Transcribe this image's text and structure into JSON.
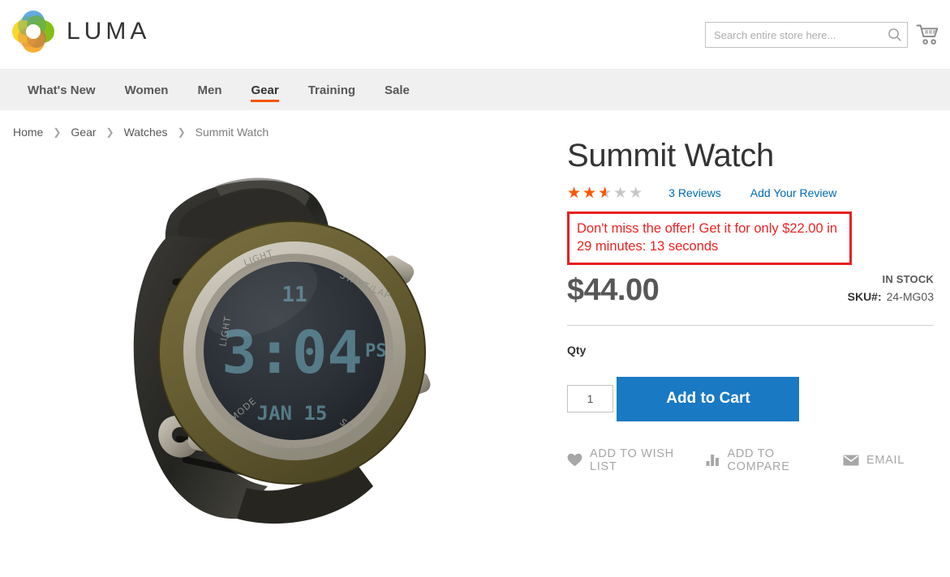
{
  "header": {
    "brand_name": "LUMA",
    "logo_icon": "luma-flower-logo",
    "search": {
      "placeholder": "Search entire store here...",
      "value": "",
      "icon": "search-icon"
    },
    "cart_icon": "shopping-cart-icon"
  },
  "nav": {
    "items": [
      {
        "label": "What's New",
        "active": false
      },
      {
        "label": "Women",
        "active": false
      },
      {
        "label": "Men",
        "active": false
      },
      {
        "label": "Gear",
        "active": true
      },
      {
        "label": "Training",
        "active": false
      },
      {
        "label": "Sale",
        "active": false
      }
    ],
    "active_color": "#f45500"
  },
  "breadcrumb": {
    "separator": "❯",
    "items": [
      "Home",
      "Gear",
      "Watches",
      "Summit Watch"
    ]
  },
  "product": {
    "title": "Summit Watch",
    "image_alt": "Summit Watch digital sport watch with black strap and olive bezel",
    "rating": {
      "value": 2.5,
      "max": 5,
      "percent": "50%",
      "star_glyph": "★★★★★",
      "color": "#ff5501"
    },
    "reviews_link": "3 Reviews",
    "add_review_link": "Add Your Review",
    "offer": {
      "text": "Don't miss the offer! Get it for only $22.00 in 29 minutes: 13 seconds",
      "offer_price": "$22.00",
      "minutes": "29",
      "seconds": "13",
      "border_color": "#e81f1f",
      "text_color": "#ef2222"
    },
    "price": "$44.00",
    "stock_status": "IN STOCK",
    "sku_label": "SKU#:",
    "sku_value": "24-MG03",
    "qty_label": "Qty",
    "qty_value": "1",
    "add_to_cart_label": "Add to Cart",
    "add_to_cart_color": "#1979c3",
    "actions": [
      {
        "label": "ADD TO WISH LIST",
        "icon": "heart-icon"
      },
      {
        "label": "ADD TO COMPARE",
        "icon": "bar-chart-icon"
      },
      {
        "label": "EMAIL",
        "icon": "envelope-icon"
      }
    ]
  }
}
